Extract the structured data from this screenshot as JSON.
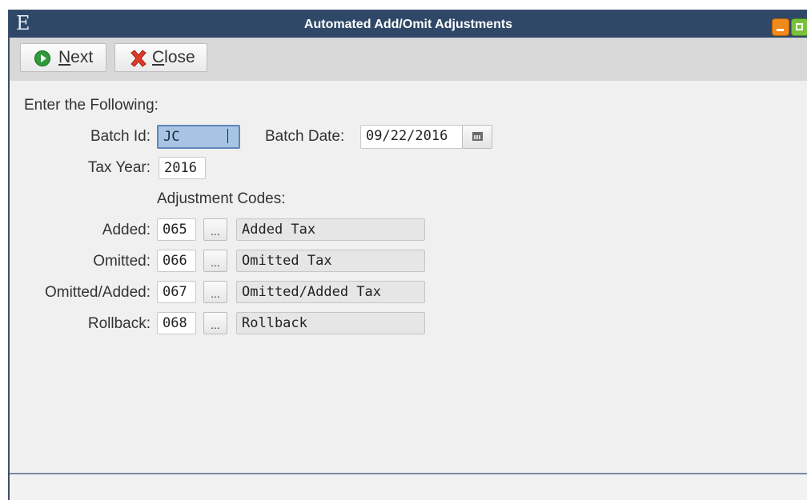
{
  "window": {
    "app_letter": "E",
    "title": "Automated Add/Omit Adjustments"
  },
  "toolbar": {
    "next_label": "Next",
    "close_label": "Close"
  },
  "form": {
    "intro": "Enter the Following:",
    "batch_id": {
      "label": "Batch Id:",
      "value": "JC"
    },
    "batch_date": {
      "label": "Batch Date:",
      "value": "09/22/2016"
    },
    "tax_year": {
      "label": "Tax Year:",
      "value": "2016"
    },
    "adjustment_codes_heading": "Adjustment Codes:",
    "codes": [
      {
        "label": "Added:",
        "code": "065",
        "description": "Added Tax",
        "lookup": "..."
      },
      {
        "label": "Omitted:",
        "code": "066",
        "description": "Omitted Tax",
        "lookup": "..."
      },
      {
        "label": "Omitted/Added:",
        "code": "067",
        "description": "Omitted/Added Tax",
        "lookup": "..."
      },
      {
        "label": "Rollback:",
        "code": "068",
        "description": "Rollback",
        "lookup": "..."
      }
    ]
  },
  "colors": {
    "titlebar": "#2f4868",
    "toolbar": "#d8d8d8",
    "selection": "#a8c4e4"
  },
  "icons": {
    "next": "next-arrow-icon",
    "close": "close-x-icon",
    "calendar": "calendar-icon"
  }
}
